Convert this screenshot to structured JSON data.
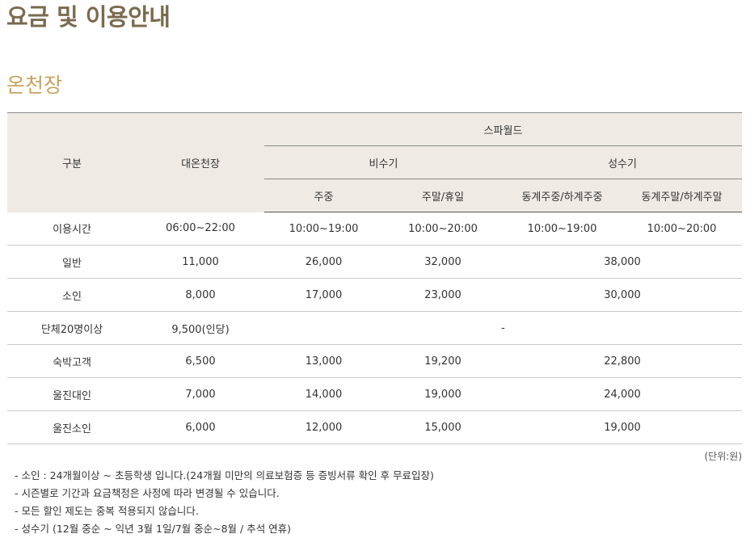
{
  "page": {
    "title": "요금 및 이용안내"
  },
  "section": {
    "title": "온천장"
  },
  "table": {
    "header": {
      "category": "구분",
      "daeoncheon": "대온천장",
      "spaworld": "스파월드",
      "off_season": "비수기",
      "peak_season": "성수기",
      "weekday": "주중",
      "weekend_holiday": "주말/휴일",
      "winter_summer_weekday": "동계주중/하계주중",
      "winter_summer_weekend": "동계주말/하계주말"
    },
    "rows": [
      {
        "category": "이용시간",
        "daeoncheon": "06:00~22:00",
        "off_weekday": "10:00~19:00",
        "off_weekend": "10:00~20:00",
        "peak_weekday": "10:00~19:00",
        "peak_weekend": "10:00~20:00"
      },
      {
        "category": "일반",
        "daeoncheon": "11,000",
        "off_weekday": "26,000",
        "off_weekend": "32,000",
        "peak": "38,000"
      },
      {
        "category": "소인",
        "daeoncheon": "8,000",
        "off_weekday": "17,000",
        "off_weekend": "23,000",
        "peak": "30,000"
      },
      {
        "category": "단체20명이상",
        "daeoncheon": "9,500(인당)",
        "spaworld": "-"
      },
      {
        "category": "숙박고객",
        "daeoncheon": "6,500",
        "off_weekday": "13,000",
        "off_weekend": "19,200",
        "peak": "22,800"
      },
      {
        "category": "울진대인",
        "daeoncheon": "7,000",
        "off_weekday": "14,000",
        "off_weekend": "19,000",
        "peak": "24,000"
      },
      {
        "category": "울진소인",
        "daeoncheon": "6,000",
        "off_weekday": "12,000",
        "off_weekend": "15,000",
        "peak": "19,000"
      }
    ]
  },
  "unit_note": "(단위:원)",
  "notes": [
    "- 소인 : 24개월이상 ~ 초등학생 입니다.(24개월 미만의 의료보험증 등 증빙서류 확인 후 무료입장)",
    "- 시즌별로 기간과 요금책정은 사정에 따라 변경될 수 있습니다.",
    "- 모든 할인 제도는 중복 적용되지 않습니다.",
    "- 성수기 (12월 중순 ~ 익년 3월 1일/7월 중순~8월 / 추석 연휴)"
  ]
}
